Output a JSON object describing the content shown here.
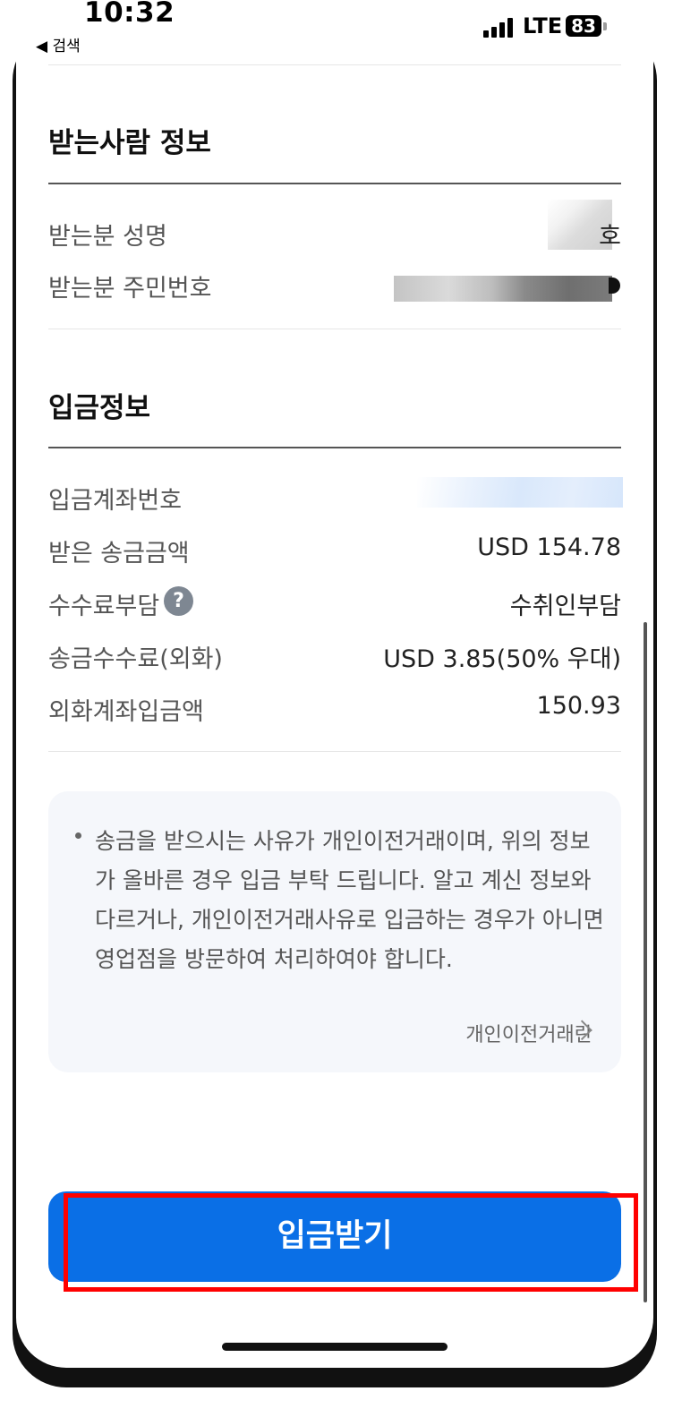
{
  "status_bar": {
    "time": "10:32",
    "back_label": "◀ 검색",
    "network": "LTE",
    "battery": "83"
  },
  "recipient_section": {
    "title": "받는사람 정보",
    "rows": [
      {
        "label": "받는분 성명",
        "value": "호"
      },
      {
        "label": "받는분 주민번호",
        "value": ""
      }
    ]
  },
  "deposit_section": {
    "title": "입금정보",
    "rows": [
      {
        "label": "입금계좌번호",
        "value": ""
      },
      {
        "label": "받은 송금금액",
        "value": "USD 154.78"
      },
      {
        "label": "수수료부담",
        "value": "수취인부담"
      },
      {
        "label": "송금수수료(외화)",
        "value": "USD 3.85(50% 우대)"
      },
      {
        "label": "외화계좌입금액",
        "value": "150.93"
      }
    ],
    "help_icon": "?"
  },
  "notice": {
    "text": "송금을 받으시는 사유가 개인이전거래이며, 위의 정보가 올바른 경우 입금 부탁 드립니다. 알고 계신 정보와 다르거나, 개인이전거래사유로 입금하는 경우가 아니면 영업점을 방문하여 처리하여야 합니다.",
    "link_label": "개인이전거래란"
  },
  "cta": {
    "label": "입금받기"
  },
  "colors": {
    "primary": "#0a6fe6",
    "highlight": "#ff0000",
    "notice_bg": "#f5f7fb"
  }
}
